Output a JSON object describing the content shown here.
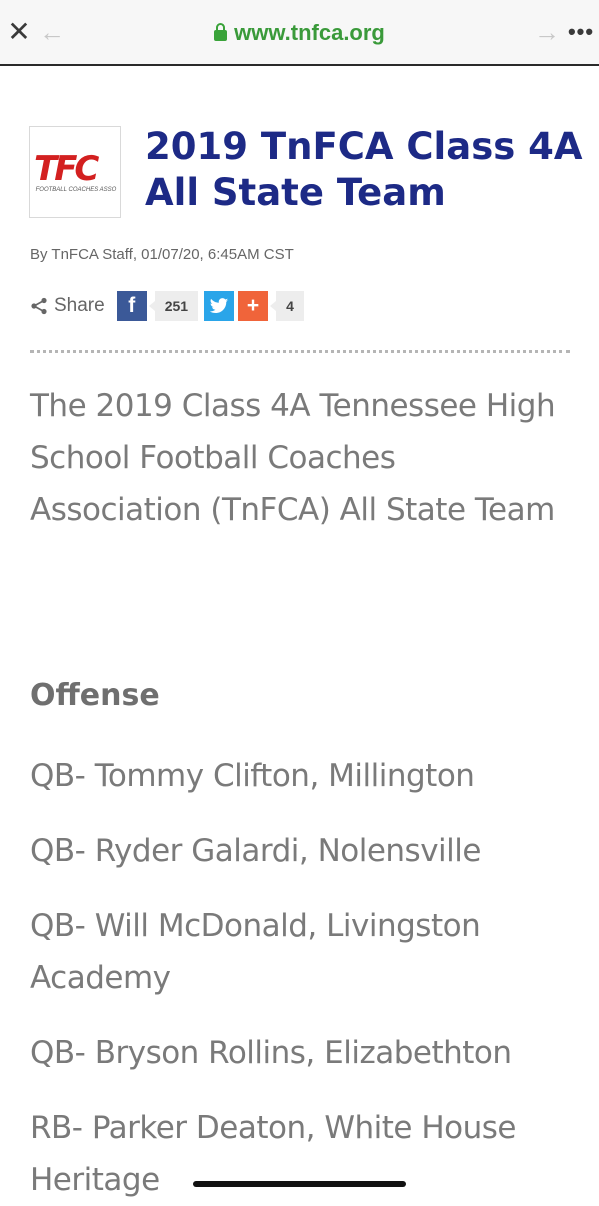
{
  "browser": {
    "url": "www.tnfca.org",
    "icons": {
      "close": "close-icon",
      "back": "back-arrow-icon",
      "forward": "forward-arrow-icon",
      "more": "more-dots-icon",
      "lock": "lock-icon"
    }
  },
  "article": {
    "logo": {
      "text": "TFC",
      "subtext": "FOOTBALL COACHES ASSO"
    },
    "title": "2019 TnFCA Class 4A All State Team",
    "byline": "By TnFCA Staff, 01/07/20, 6:45AM CST",
    "share": {
      "label": "Share",
      "facebook_count": "251",
      "plus_count": "4"
    },
    "intro": "The 2019 Class 4A  Tennessee High School Football Coaches Association (TnFCA) All State Team",
    "section": "Offense",
    "entries": [
      "QB- Tommy Clifton, Millington",
      "QB- Ryder Galardi, Nolensville",
      "QB- Will McDonald, Livingston Academy",
      "QB- Bryson Rollins, Elizabethton",
      "RB- Parker Deaton, White House Heritage"
    ]
  },
  "colors": {
    "title": "#1d2a86",
    "url": "#3a9a3a",
    "facebook": "#3b5998",
    "twitter": "#2aa5e9",
    "plus": "#f0643a",
    "logo": "#d32020"
  }
}
